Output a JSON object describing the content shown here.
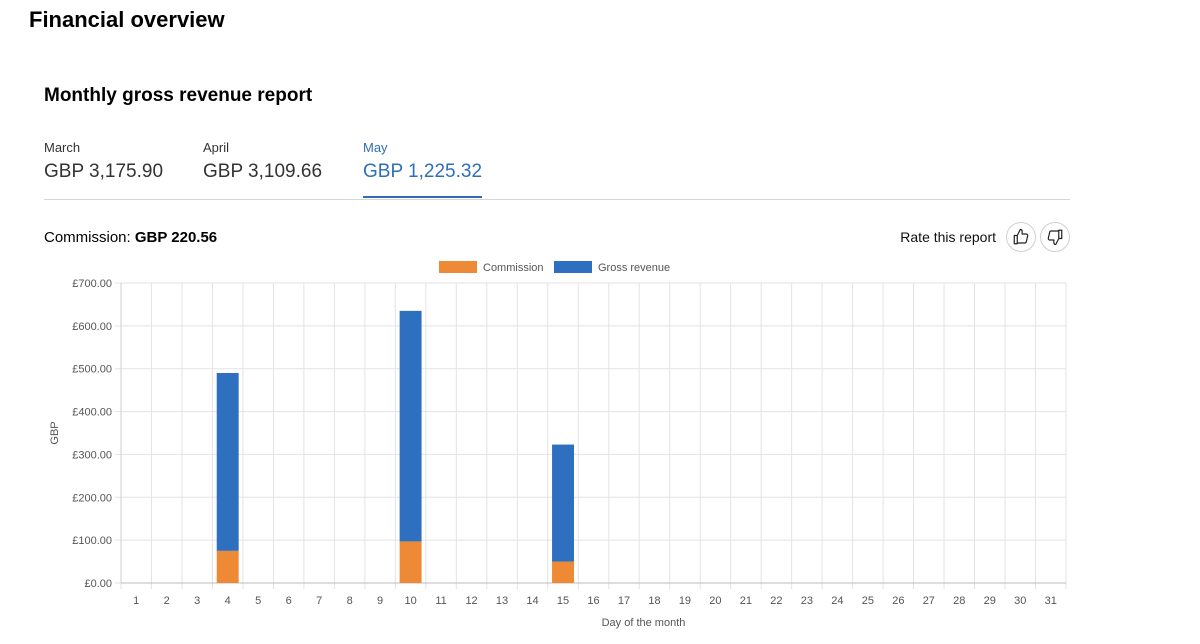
{
  "page": {
    "title": "Financial overview"
  },
  "report": {
    "title": "Monthly gross revenue report",
    "months": [
      {
        "name": "March",
        "value": "GBP 3,175.90"
      },
      {
        "name": "April",
        "value": "GBP 3,109.66"
      },
      {
        "name": "May",
        "value": "GBP 1,225.32"
      }
    ],
    "active_month": "May",
    "commission_label": "Commission:",
    "commission_value": "GBP 220.56",
    "rate_label": "Rate this report"
  },
  "icons": {
    "thumbs_up": "thumbs-up-icon",
    "thumbs_down": "thumbs-down-icon"
  },
  "colors": {
    "accent": "#2f6fb8",
    "commission": "#ee8a35",
    "gross": "#2f6fbf"
  },
  "chart_data": {
    "type": "bar",
    "stacked": true,
    "categories": [
      "1",
      "2",
      "3",
      "4",
      "5",
      "6",
      "7",
      "8",
      "9",
      "10",
      "11",
      "12",
      "13",
      "14",
      "15",
      "16",
      "17",
      "18",
      "19",
      "20",
      "21",
      "22",
      "23",
      "24",
      "25",
      "26",
      "27",
      "28",
      "29",
      "30",
      "31"
    ],
    "series": [
      {
        "name": "Commission",
        "color": "#ee8a35",
        "values": [
          0,
          0,
          0,
          75,
          0,
          0,
          0,
          0,
          0,
          97,
          0,
          0,
          0,
          0,
          50,
          0,
          0,
          0,
          0,
          0,
          0,
          0,
          0,
          0,
          0,
          0,
          0,
          0,
          0,
          0,
          0
        ]
      },
      {
        "name": "Gross revenue",
        "color": "#2f6fbf",
        "values": [
          0,
          0,
          0,
          415,
          0,
          0,
          0,
          0,
          0,
          538,
          0,
          0,
          0,
          0,
          273,
          0,
          0,
          0,
          0,
          0,
          0,
          0,
          0,
          0,
          0,
          0,
          0,
          0,
          0,
          0,
          0
        ]
      }
    ],
    "ylim": [
      0,
      700
    ],
    "yticks": [
      "£0.00",
      "£100.00",
      "£200.00",
      "£300.00",
      "£400.00",
      "£500.00",
      "£600.00",
      "£700.00"
    ],
    "ylabel": "GBP",
    "xlabel": "Day of the month",
    "grid": true,
    "legend_position": "top-center"
  }
}
